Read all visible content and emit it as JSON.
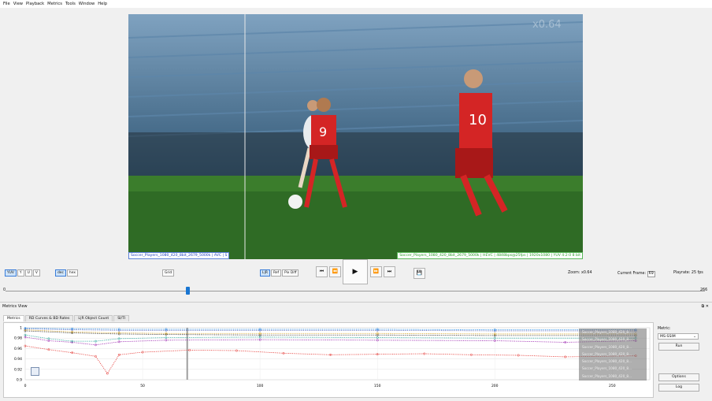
{
  "menu": [
    "File",
    "View",
    "Playback",
    "Metrics",
    "Tools",
    "Window",
    "Help"
  ],
  "video": {
    "left_label": "Soccer_Players_1080_420_8bit_2679_5000k | AVC | S",
    "right_label": "Soccer_Players_1080_420_8bit_2679_5000k | HEVC | 4848bps@25fps | 1920x1080 | YUV 4:2:0 8 bit",
    "zoom_overlay": "x0.64"
  },
  "controls": {
    "yuv": "YUV",
    "y": "Y",
    "u": "U",
    "v": "V",
    "dec": "dec",
    "hex": "hex",
    "grid": "Grid",
    "lr": "L|R",
    "ref": "Ref",
    "pixdiff": "Pix Diff",
    "zoom_label": "Zoom:",
    "zoom_value": "x0.64",
    "frame_label": "Current Frame:",
    "frame_value": "69",
    "playrate_label": "Playrate:",
    "playrate_value": "25",
    "playrate_unit": "fps",
    "slider_min": "0",
    "slider_max": "266",
    "slider_pos": 0.26
  },
  "metrics_view": {
    "title": "Metrics View",
    "tabs": [
      "Metrics",
      "RD Curves & BD Rates",
      "L|R Object Count",
      "SI/TI"
    ],
    "metric_label": "Metric:",
    "metric_value": "MS-SSIM",
    "run": "Run",
    "options": "Options",
    "log": "Log",
    "legend": [
      "Soccer_Players_1080_420_8...",
      "Soccer_Players_1080_420_8...",
      "Soccer_Players_1080_420_8...",
      "Soccer_Players_1080_420_8...",
      "Soccer_Players_1080_420_8...",
      "Soccer_Players_1080_420_8...",
      "Soccer_Players_1080_420_8..."
    ]
  },
  "chart_data": {
    "type": "line",
    "xlim": [
      0,
      266
    ],
    "ylim": [
      0.9,
      1.0
    ],
    "x_ticks": [
      "0",
      "50",
      "100",
      "150",
      "200",
      "250"
    ],
    "y_ticks": [
      "1",
      "0.98",
      "0.96",
      "0.94",
      "0.92",
      "0.9"
    ],
    "current_frame_marker": 69,
    "series": [
      {
        "color": "#e53935",
        "x": [
          0,
          10,
          20,
          30,
          35,
          40,
          50,
          70,
          90,
          110,
          130,
          150,
          170,
          190,
          210,
          230,
          260
        ],
        "y": [
          0.965,
          0.958,
          0.952,
          0.945,
          0.912,
          0.948,
          0.953,
          0.957,
          0.956,
          0.951,
          0.948,
          0.949,
          0.95,
          0.948,
          0.947,
          0.944,
          0.946
        ]
      },
      {
        "color": "#9c27b0",
        "x": [
          0,
          10,
          20,
          30,
          40,
          60,
          100,
          150,
          200,
          230,
          260
        ],
        "y": [
          0.982,
          0.975,
          0.972,
          0.967,
          0.973,
          0.976,
          0.977,
          0.976,
          0.975,
          0.972,
          0.975
        ]
      },
      {
        "color": "#26a69a",
        "x": [
          0,
          10,
          20,
          30,
          40,
          60,
          100,
          150,
          200,
          260
        ],
        "y": [
          0.986,
          0.979,
          0.974,
          0.974,
          0.979,
          0.981,
          0.982,
          0.981,
          0.98,
          0.98
        ]
      },
      {
        "color": "#333333",
        "x": [
          0,
          20,
          40,
          60,
          100,
          150,
          200,
          260
        ],
        "y": [
          0.994,
          0.99,
          0.988,
          0.987,
          0.986,
          0.986,
          0.985,
          0.985
        ]
      },
      {
        "color": "#d4a017",
        "x": [
          0,
          20,
          40,
          60,
          100,
          150,
          200,
          260
        ],
        "y": [
          0.996,
          0.992,
          0.99,
          0.989,
          0.989,
          0.989,
          0.988,
          0.988
        ]
      },
      {
        "color": "#5c6bc0",
        "x": [
          0,
          20,
          40,
          60,
          100,
          150,
          200,
          260
        ],
        "y": [
          0.998,
          0.996,
          0.995,
          0.995,
          0.995,
          0.995,
          0.994,
          0.994
        ]
      },
      {
        "color": "#1e88e5",
        "x": [
          0,
          20,
          40,
          60,
          100,
          150,
          200,
          260
        ],
        "y": [
          0.999,
          0.998,
          0.997,
          0.997,
          0.997,
          0.997,
          0.996,
          0.996
        ]
      }
    ]
  }
}
